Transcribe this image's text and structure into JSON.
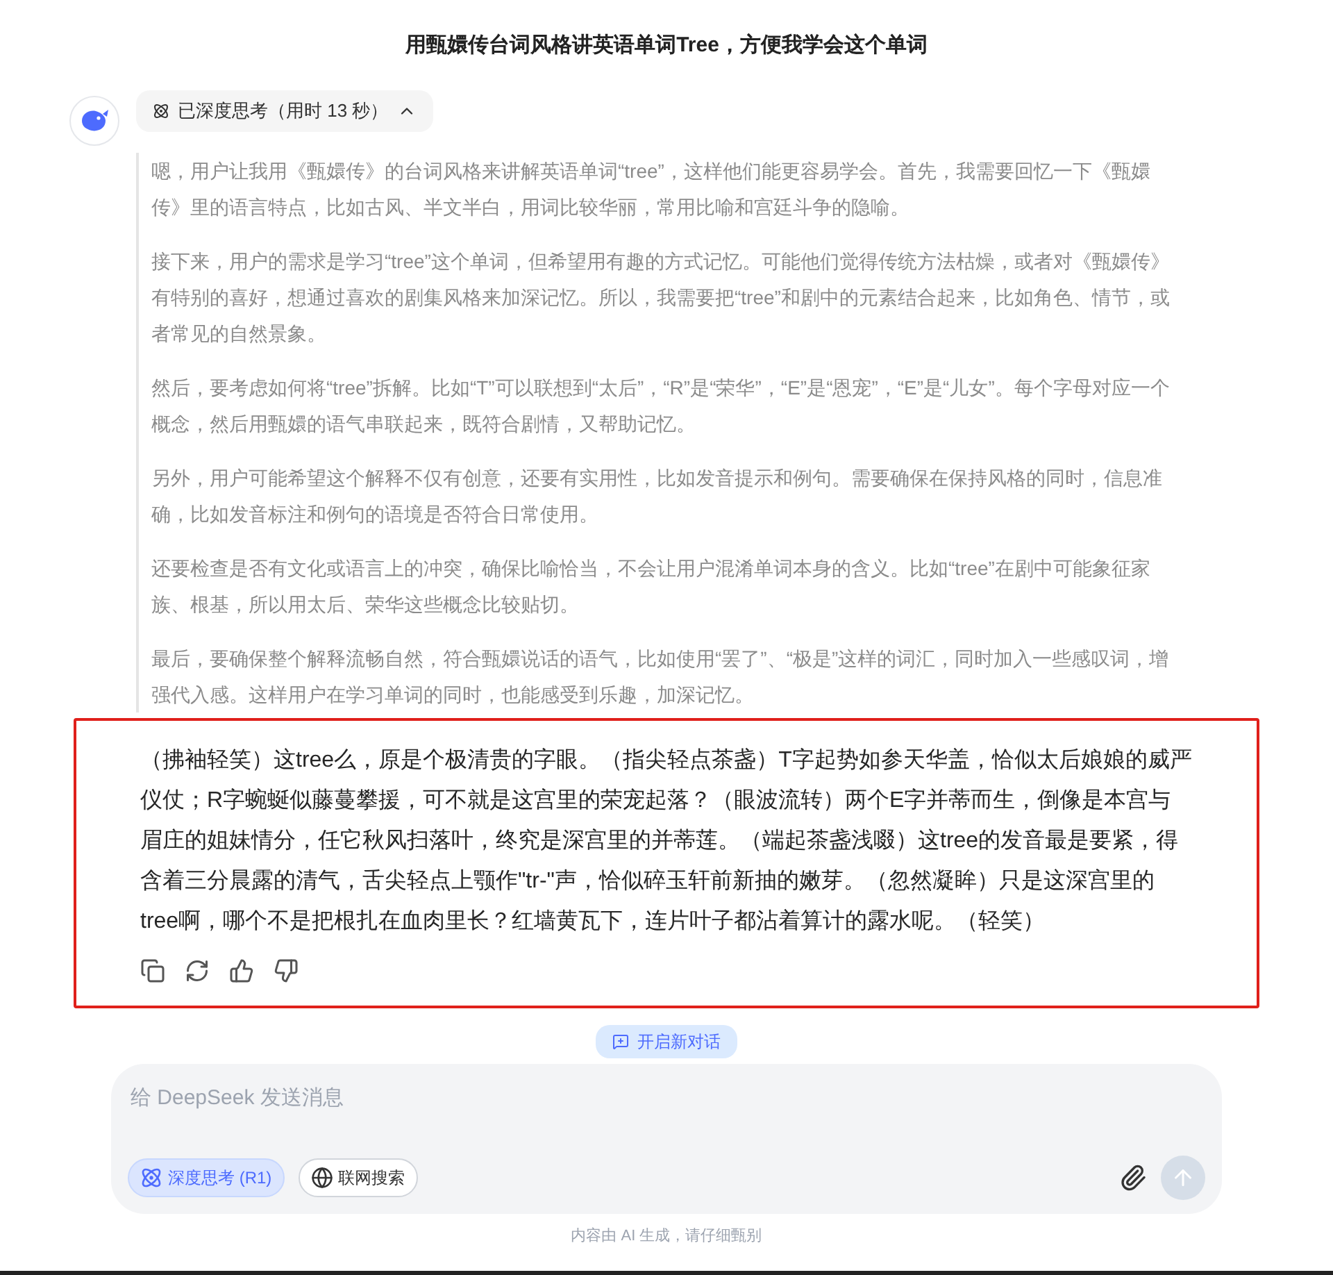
{
  "title": "用甄嬛传台词风格讲英语单词Tree，方便我学会这个单词",
  "thinking": {
    "label": "已深度思考（用时 13 秒）",
    "expanded": true,
    "paragraphs": [
      "嗯，用户让我用《甄嬛传》的台词风格来讲解英语单词“tree”，这样他们能更容易学会。首先，我需要回忆一下《甄嬛传》里的语言特点，比如古风、半文半白，用词比较华丽，常用比喻和宫廷斗争的隐喻。",
      "接下来，用户的需求是学习“tree”这个单词，但希望用有趣的方式记忆。可能他们觉得传统方法枯燥，或者对《甄嬛传》有特别的喜好，想通过喜欢的剧集风格来加深记忆。所以，我需要把“tree”和剧中的元素结合起来，比如角色、情节，或者常见的自然景象。",
      "然后，要考虑如何将“tree”拆解。比如“T”可以联想到“太后”，“R”是“荣华”，“E”是“恩宠”，“E”是“儿女”。每个字母对应一个概念，然后用甄嬛的语气串联起来，既符合剧情，又帮助记忆。",
      "另外，用户可能希望这个解释不仅有创意，还要有实用性，比如发音提示和例句。需要确保在保持风格的同时，信息准确，比如发音标注和例句的语境是否符合日常使用。",
      "还要检查是否有文化或语言上的冲突，确保比喻恰当，不会让用户混淆单词本身的含义。比如“tree”在剧中可能象征家族、根基，所以用太后、荣华这些概念比较贴切。",
      "最后，要确保整个解释流畅自然，符合甄嬛说话的语气，比如使用“罢了”、“极是”这样的词汇，同时加入一些感叹词，增强代入感。这样用户在学习单词的同时，也能感受到乐趣，加深记忆。"
    ]
  },
  "answer": "（拂袖轻笑）这tree么，原是个极清贵的字眼。（指尖轻点茶盏）T字起势如参天华盖，恰似太后娘娘的威严仪仗；R字蜿蜒似藤蔓攀援，可不就是这宫里的荣宠起落？（眼波流转）两个E字并蒂而生，倒像是本宫与眉庄的姐妹情分，任它秋风扫落叶，终究是深宫里的并蒂莲。（端起茶盏浅啜）这tree的发音最是要紧，得含着三分晨露的清气，舌尖轻点上颚作\"tr-\"声，恰似碎玉轩前新抽的嫩芽。（忽然凝眸）只是这深宫里的tree啊，哪个不是把根扎在血肉里长？红墙黄瓦下，连片叶子都沾着算计的露水呢。（轻笑）",
  "new_chat": "开启新对话",
  "input": {
    "placeholder": "给 DeepSeek 发送消息"
  },
  "toggles": [
    {
      "label": "深度思考 (R1)",
      "selected": true
    },
    {
      "label": "联网搜索",
      "selected": false
    }
  ],
  "footer": "内容由 AI 生成，请仔细甄别"
}
